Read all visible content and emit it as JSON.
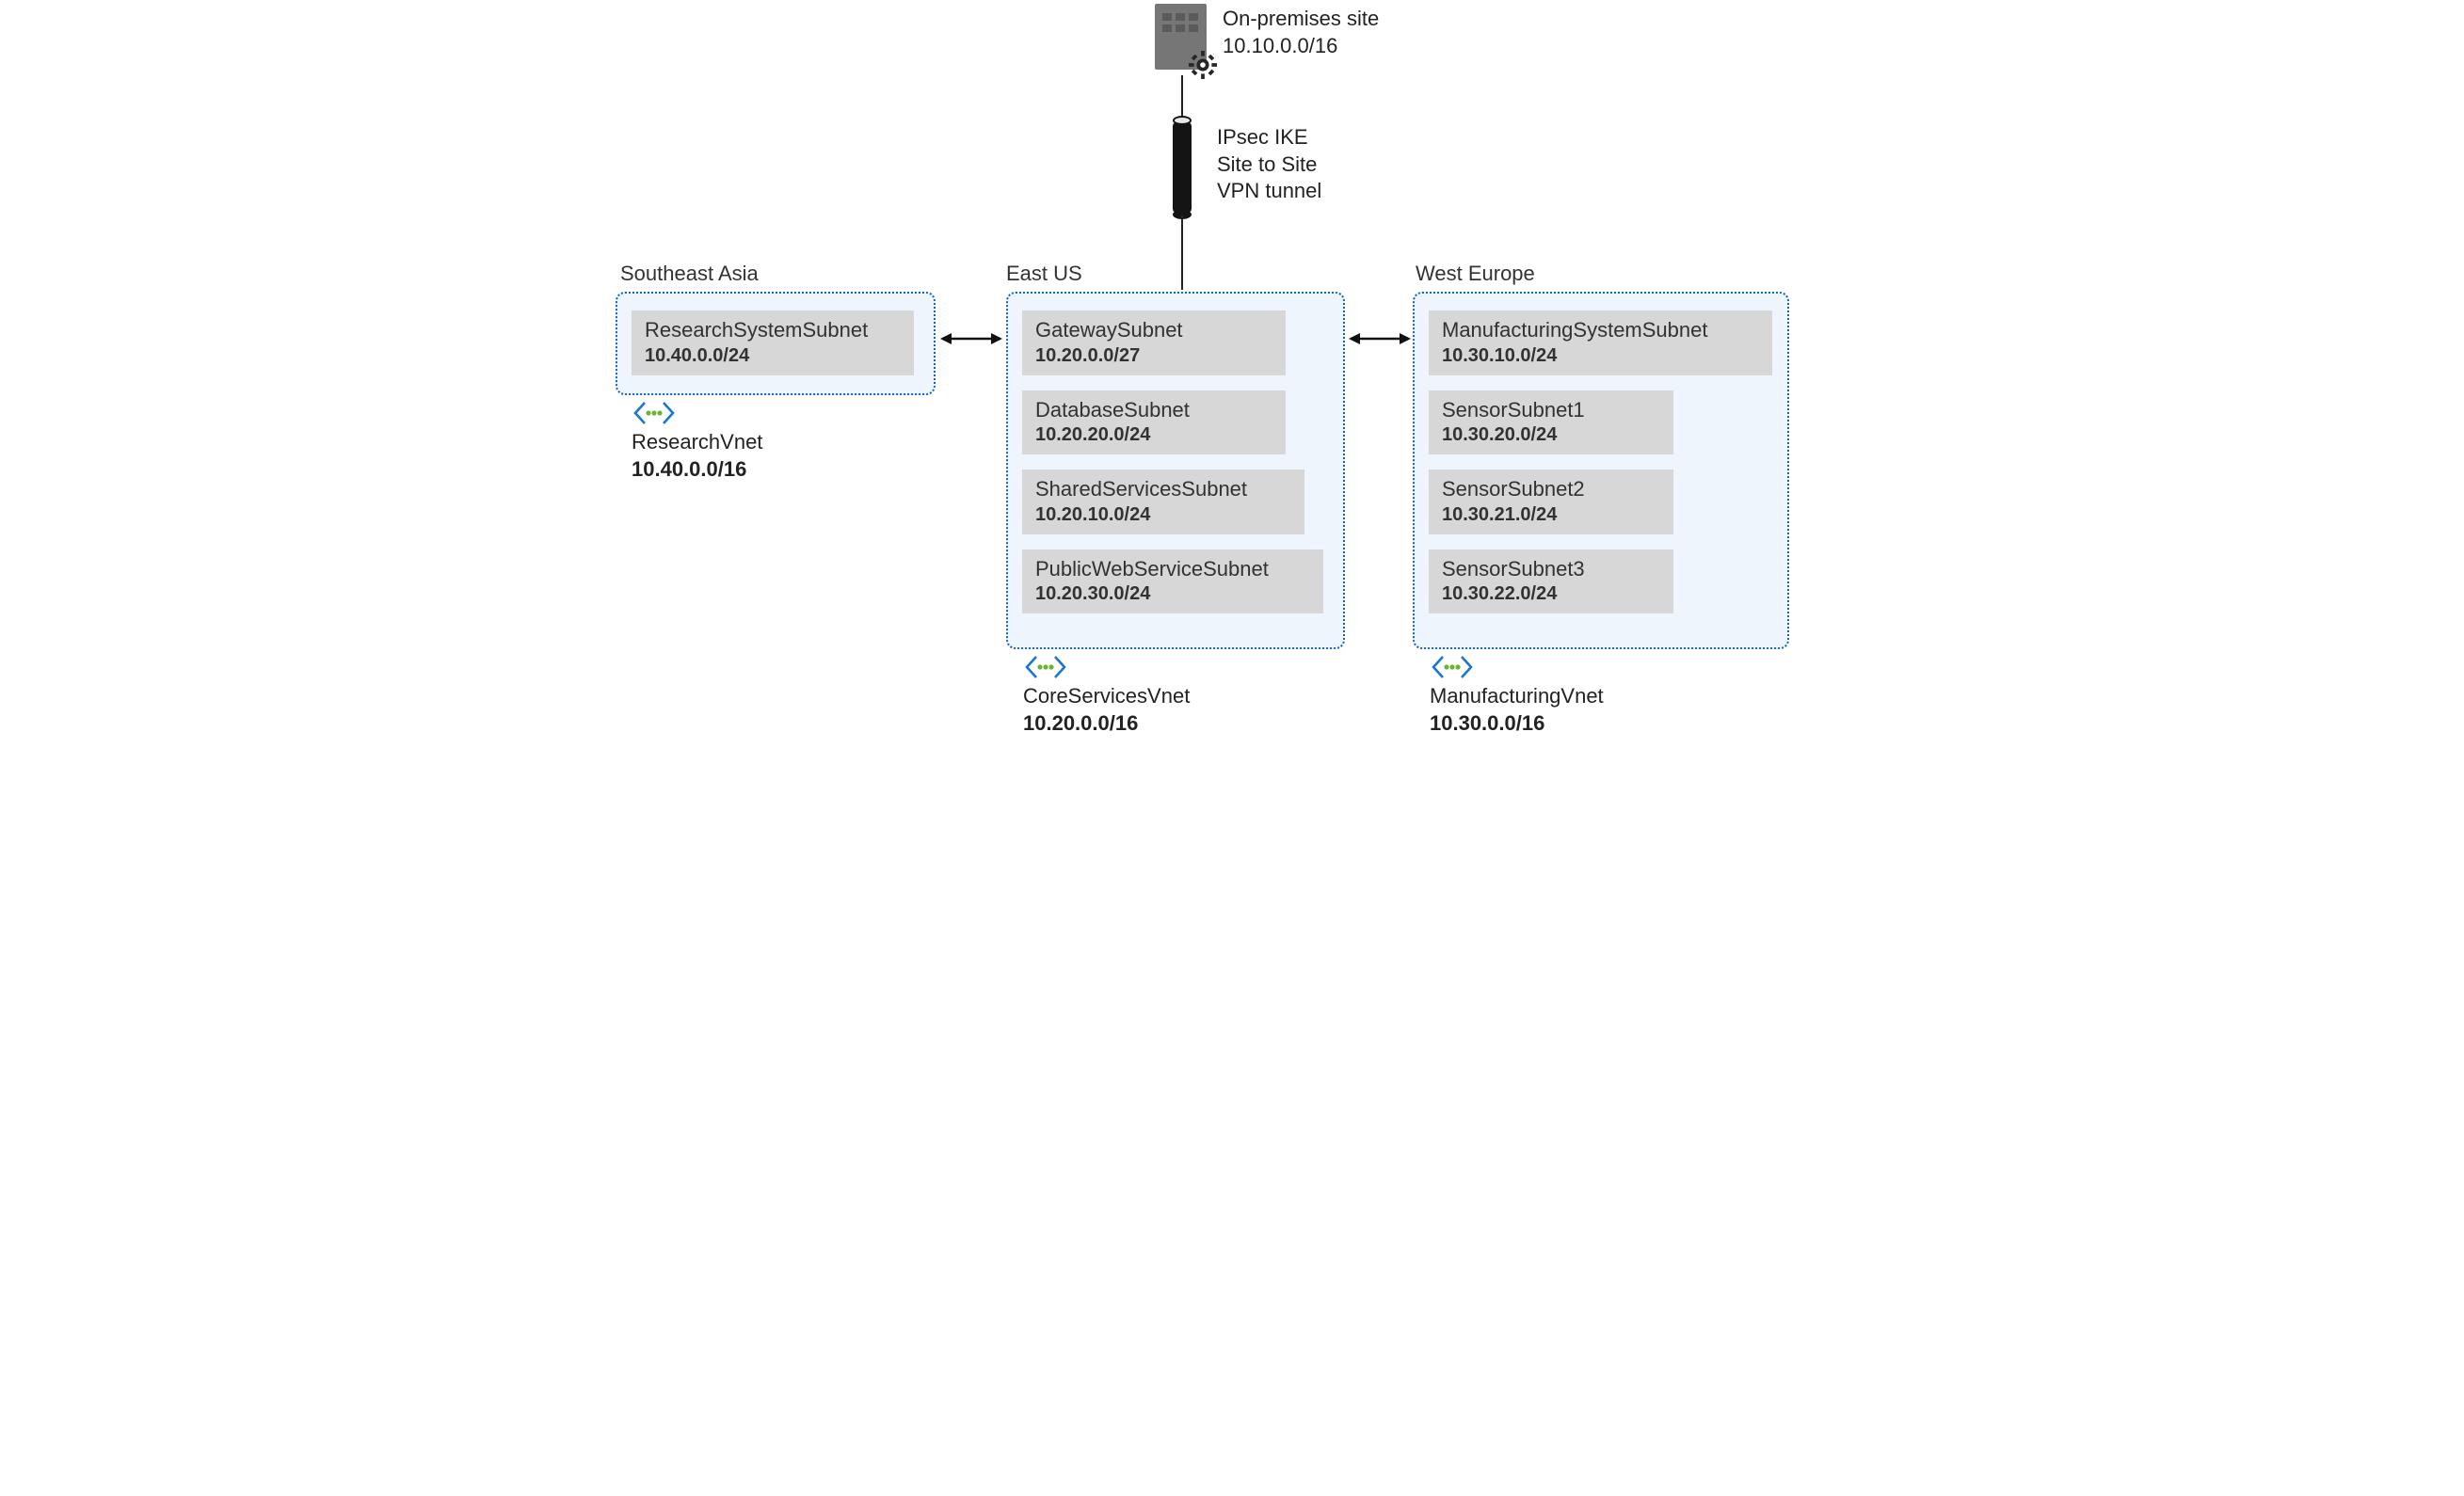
{
  "onprem": {
    "title": "On-premises site",
    "cidr": "10.10.0.0/16"
  },
  "tunnel": {
    "line1": "IPsec IKE",
    "line2": "Site to Site",
    "line3": "VPN tunnel"
  },
  "regions": {
    "sea": {
      "label": "Southeast Asia"
    },
    "eus": {
      "label": "East US"
    },
    "weu": {
      "label": "West Europe"
    }
  },
  "vnets": {
    "research": {
      "name": "ResearchVnet",
      "cidr": "10.40.0.0/16",
      "subnets": [
        {
          "name": "ResearchSystemSubnet",
          "cidr": "10.40.0.0/24"
        }
      ]
    },
    "core": {
      "name": "CoreServicesVnet",
      "cidr": "10.20.0.0/16",
      "subnets": [
        {
          "name": "GatewaySubnet",
          "cidr": "10.20.0.0/27"
        },
        {
          "name": "DatabaseSubnet",
          "cidr": "10.20.20.0/24"
        },
        {
          "name": "SharedServicesSubnet",
          "cidr": "10.20.10.0/24"
        },
        {
          "name": "PublicWebServiceSubnet",
          "cidr": "10.20.30.0/24"
        }
      ]
    },
    "mfg": {
      "name": "ManufacturingVnet",
      "cidr": "10.30.0.0/16",
      "subnets": [
        {
          "name": "ManufacturingSystemSubnet",
          "cidr": "10.30.10.0/24"
        },
        {
          "name": "SensorSubnet1",
          "cidr": "10.30.20.0/24"
        },
        {
          "name": "SensorSubnet2",
          "cidr": "10.30.21.0/24"
        },
        {
          "name": "SensorSubnet3",
          "cidr": "10.30.22.0/24"
        }
      ]
    }
  }
}
